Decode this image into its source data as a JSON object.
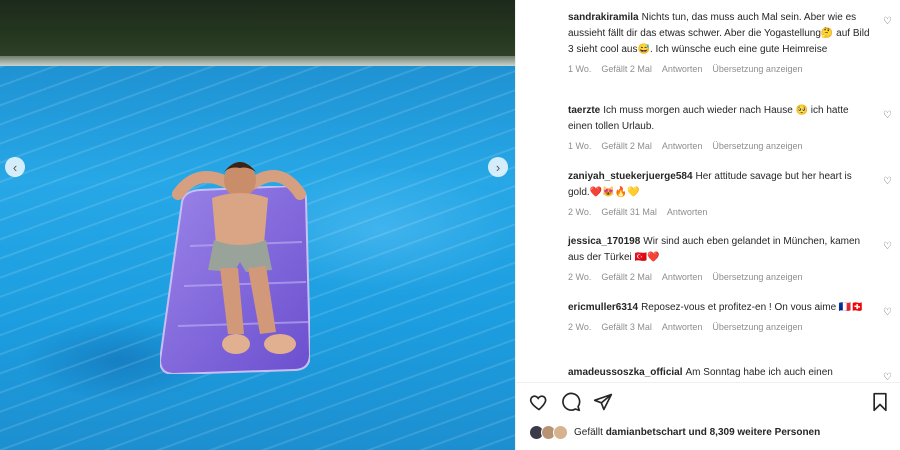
{
  "comments": [
    {
      "username": "sandrakiramila",
      "text": "Nichts tun, das muss auch Mal sein. Aber wie es aussieht fällt dir das etwas schwer. Aber die Yogastellung🤔 auf Bild 3 sieht cool aus😅. Ich wünsche euch eine gute Heimreise",
      "time": "1 Wo.",
      "likes": "Gefällt 2 Mal",
      "reply": "Antworten",
      "translate": "Übersetzung anzeigen",
      "avatar_color": "#c9a98a"
    },
    {
      "username": "taerzte",
      "text": "Ich muss morgen auch wieder nach Hause 🥺 ich hatte einen tollen Urlaub.",
      "time": "1 Wo.",
      "likes": "Gefällt 2 Mal",
      "reply": "Antworten",
      "translate": "Übersetzung anzeigen",
      "avatar_color": "#6b2f2f"
    },
    {
      "username": "zaniyah_stuekerjuerge584",
      "text": "Her attitude savage but her heart is gold.❤️😻🔥💛",
      "time": "2 Wo.",
      "likes": "Gefällt 31 Mal",
      "reply": "Antworten",
      "translate": "",
      "avatar_color": "#d9d9d9"
    },
    {
      "username": "jessica_170198",
      "text": "Wir sind auch eben gelandet in München, kamen aus der Türkei 🇹🇷❤️",
      "time": "2 Wo.",
      "likes": "Gefällt 2 Mal",
      "reply": "Antworten",
      "translate": "Übersetzung anzeigen",
      "avatar_color": "#b87a4b"
    },
    {
      "username": "ericmuller6314",
      "text": "Reposez-vous et profitez-en ! On vous aime 🇫🇷🇨🇭",
      "time": "2 Wo.",
      "likes": "Gefällt 3 Mal",
      "reply": "Antworten",
      "translate": "Übersetzung anzeigen",
      "avatar_color": "#6f8aa6"
    },
    {
      "username": "amadeussoszka_official",
      "text": "Am Sonntag habe ich auch einen",
      "time": "",
      "likes": "",
      "reply": "",
      "translate": "",
      "avatar_color": "#c08a5a"
    }
  ],
  "likes_bar": {
    "prefix": "Gefällt",
    "user": "damianbetschart",
    "suffix": "und 8,309 weitere Personen"
  },
  "icons": {
    "like": "heart-outline-icon",
    "comment": "comment-bubble-icon",
    "share": "paper-plane-icon",
    "save": "bookmark-icon",
    "prev": "chevron-left-icon",
    "next": "chevron-right-icon"
  }
}
